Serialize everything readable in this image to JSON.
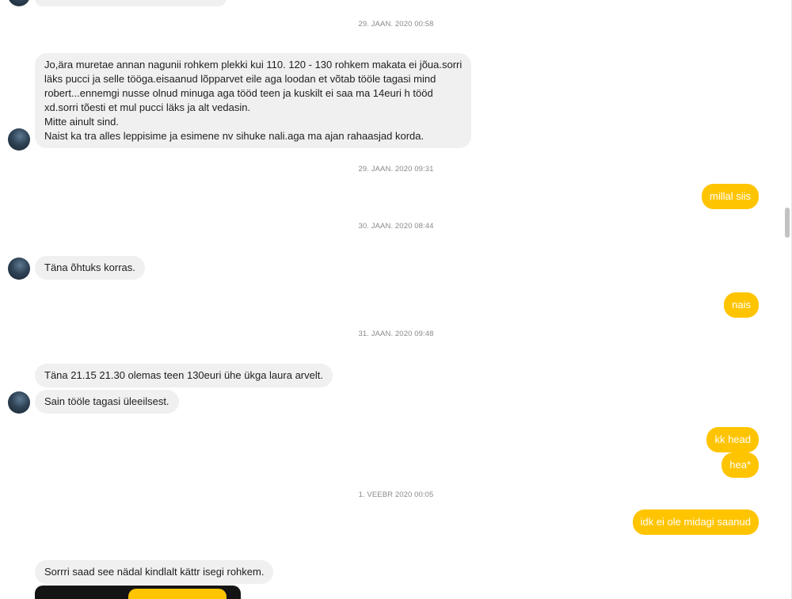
{
  "colors": {
    "incoming_bubble": "#f0f0f0",
    "outgoing_bubble": "#ffc400",
    "timestamp_text": "#8a8a8a"
  },
  "timestamps": [
    "29. JAAN. 2020 00:58",
    "29. JAAN. 2020 09:31",
    "30. JAAN. 2020 08:44",
    "31. JAAN. 2020 09:48",
    "1. VEEBR 2020 00:05"
  ],
  "messages": {
    "m1": {
      "line1": "Jo,ära muretae annan nagunii rohkem plekki kui 110. 120 - 130 rohkem makata ei jõua.sorri",
      "line2": "läks pucci ja selle tööga.eisaanud lõpparvet eile aga loodan et võtab tööle tagasi mind",
      "line3": "robert...ennemgi nusse olnud minuga aga tööd teen ja kuskilt ei saa ma 14euri h tööd",
      "line4": "xd.sorri tõesti et mul pucci läks ja alt vedasin.",
      "line5": "Mitte ainult sind.",
      "line6": "Naist ka tra alles leppisime ja esimene nv sihuke nali.aga ma ajan rahaasjad korda."
    },
    "m2": "millal siis",
    "m3": "Täna õhtuks korras.",
    "m4": "nais",
    "m5": "Täna 21.15 21.30 olemas teen 130euri ühe ükga laura arvelt.",
    "m6": "Sain tööle tagasi üleeilsest.",
    "m7": "kk head",
    "m8": "hea*",
    "m9": "idk ei ole midagi saanud",
    "m10": "Sorrri saad see nädal kindlalt kättr isegi rohkem."
  }
}
